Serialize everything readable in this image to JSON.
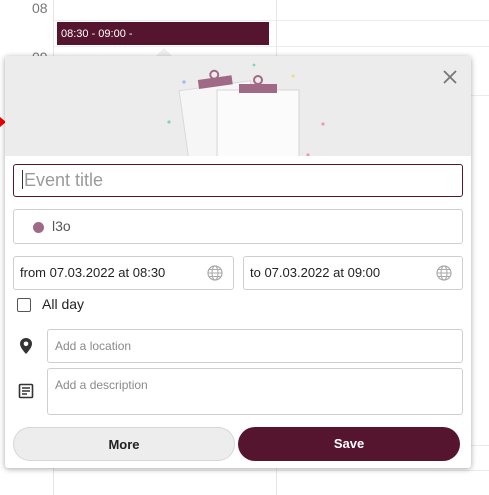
{
  "calendar": {
    "hours": [
      "08",
      "09"
    ],
    "event": {
      "time_label": "08:30 - 09:00 -"
    }
  },
  "popup": {
    "title_placeholder": "Event title",
    "calendar_name": "l3o",
    "calendar_color": "#a06a86",
    "from_text": "from 07.03.2022 at 08:30",
    "to_text": "to 07.03.2022 at 09:00",
    "all_day_label": "All day",
    "all_day_checked": false,
    "location_placeholder": "Add a location",
    "description_placeholder": "Add a description",
    "more_label": "More",
    "save_label": "Save"
  },
  "colors": {
    "accent": "#55152e"
  }
}
